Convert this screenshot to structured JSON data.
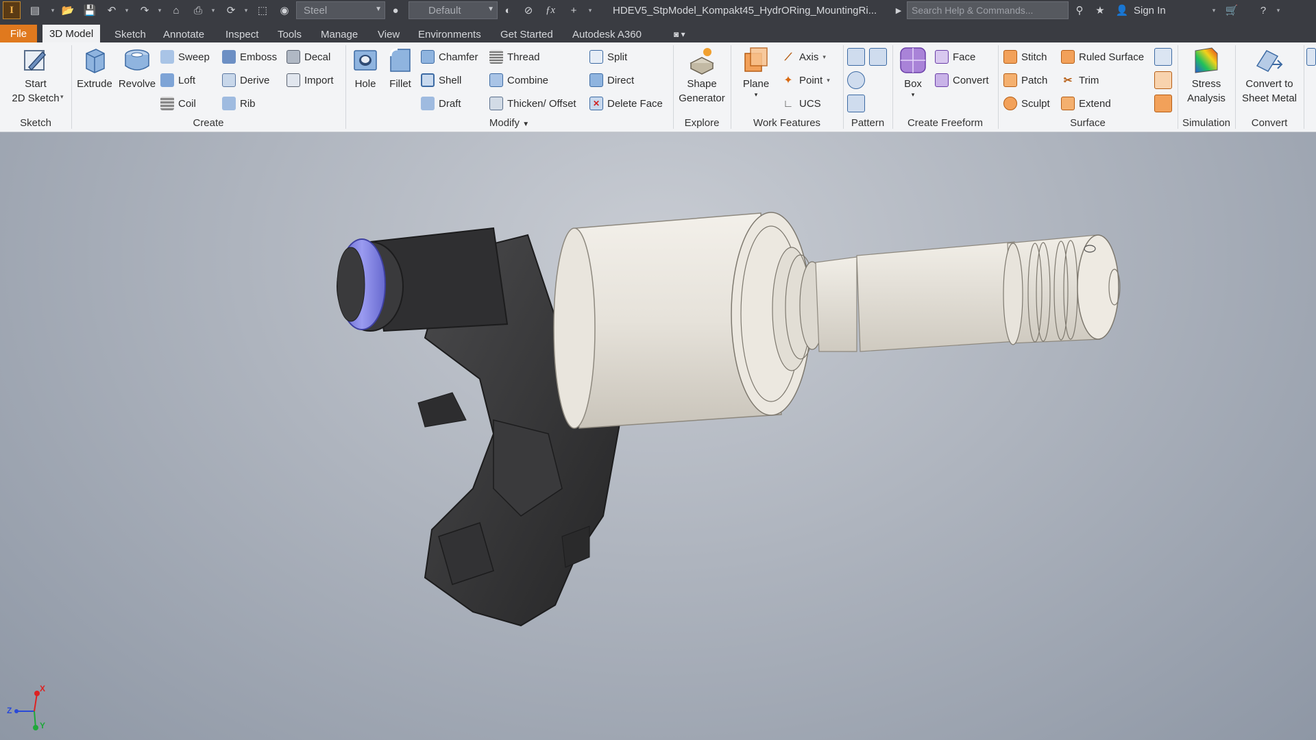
{
  "app": {
    "logo_text": "I",
    "logo_sub": "PRO",
    "material": "Steel",
    "appearance": "Default",
    "document_title": "HDEV5_StpModel_Kompakt45_HydrORing_MountingRi...",
    "search_placeholder": "Search Help & Commands...",
    "sign_in": "Sign In"
  },
  "tabs": [
    {
      "label": "File"
    },
    {
      "label": "3D Model"
    },
    {
      "label": "Sketch"
    },
    {
      "label": "Annotate"
    },
    {
      "label": "Inspect"
    },
    {
      "label": "Tools"
    },
    {
      "label": "Manage"
    },
    {
      "label": "View"
    },
    {
      "label": "Environments"
    },
    {
      "label": "Get Started"
    },
    {
      "label": "Autodesk A360"
    }
  ],
  "panels": {
    "sketch": {
      "title": "Sketch",
      "start_line1": "Start",
      "start_line2": "2D Sketch"
    },
    "create": {
      "title": "Create",
      "extrude": "Extrude",
      "revolve": "Revolve",
      "sweep": "Sweep",
      "loft": "Loft",
      "coil": "Coil",
      "emboss": "Emboss",
      "derive": "Derive",
      "rib": "Rib",
      "decal": "Decal",
      "import": "Import"
    },
    "modify": {
      "title": "Modify",
      "hole": "Hole",
      "fillet": "Fillet",
      "chamfer": "Chamfer",
      "shell": "Shell",
      "draft": "Draft",
      "thread": "Thread",
      "combine": "Combine",
      "thicken": "Thicken/ Offset",
      "split": "Split",
      "direct": "Direct",
      "delete_face": "Delete Face"
    },
    "explore": {
      "title": "Explore",
      "shape_line1": "Shape",
      "shape_line2": "Generator"
    },
    "work_features": {
      "title": "Work Features",
      "plane": "Plane",
      "axis": "Axis",
      "point": "Point",
      "ucs": "UCS"
    },
    "pattern": {
      "title": "Pattern"
    },
    "freeform": {
      "title": "Create Freeform",
      "box": "Box",
      "face": "Face",
      "convert": "Convert"
    },
    "surface": {
      "title": "Surface",
      "stitch": "Stitch",
      "patch": "Patch",
      "sculpt": "Sculpt",
      "ruled_surface": "Ruled Surface",
      "trim": "Trim",
      "extend": "Extend"
    },
    "simulation": {
      "title": "Simulation",
      "stress_line1": "Stress",
      "stress_line2": "Analysis"
    },
    "convert": {
      "title": "Convert",
      "sheet_line1": "Convert to",
      "sheet_line2": "Sheet Metal"
    }
  },
  "triad": {
    "z_label": "Z",
    "x_label": "X",
    "y_label": "Y"
  },
  "colors": {
    "accent": "#e0791e",
    "ribbon_bg": "#f3f4f6",
    "titlebar": "#3a3c42",
    "oring": "#7d7ee0"
  }
}
